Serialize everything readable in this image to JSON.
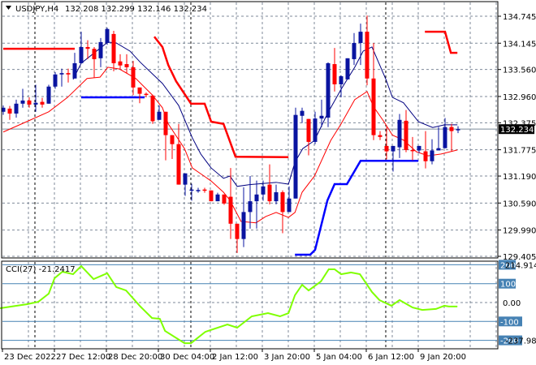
{
  "header": {
    "collapse_icon": "triangle-down-icon",
    "symbol": "USDJPY,H4",
    "ohlc": "132.208 132.299 132.146 132.234"
  },
  "colors": {
    "bull": "#0a14a0",
    "bear": "#ff0000",
    "ma_fast": "#000080",
    "ma_slow": "#ff0000",
    "resistance": "#ff0000",
    "support": "#0000ff",
    "cci": "#7fff00",
    "cci_level": "#4682b4",
    "grid": "#7f8a99"
  },
  "chart_data": [
    {
      "type": "candlestick",
      "title": "USDJPY,H4",
      "ylim": [
        129.405,
        134.745
      ],
      "price_ticks": [
        "134.745",
        "134.145",
        "133.560",
        "132.960",
        "132.375",
        "131.775",
        "131.190",
        "130.590",
        "129.990",
        "129.405"
      ],
      "current_price": "132.234",
      "x_labels": [
        {
          "index": 0,
          "label": "23 Dec 2022"
        },
        {
          "index": 8,
          "label": "27 Dec 12:00"
        },
        {
          "index": 16,
          "label": "28 Dec 20:00"
        },
        {
          "index": 24,
          "label": "30 Dec 04:00"
        },
        {
          "index": 32,
          "label": "2 Jan 12:00"
        },
        {
          "index": 40,
          "label": "3 Jan 20:00"
        },
        {
          "index": 48,
          "label": "5 Jan 04:00"
        },
        {
          "index": 56,
          "label": "6 Jan 12:00"
        },
        {
          "index": 64,
          "label": "9 Jan 20:00"
        }
      ],
      "period_separators": [
        5,
        29,
        59
      ],
      "candles_ohlc": [
        [
          132.62,
          132.76,
          132.55,
          132.71
        ],
        [
          132.69,
          132.75,
          132.44,
          132.58
        ],
        [
          132.58,
          132.89,
          132.49,
          132.8
        ],
        [
          132.8,
          133.13,
          132.71,
          132.87
        ],
        [
          132.87,
          132.94,
          132.71,
          132.78
        ],
        [
          132.78,
          133.22,
          132.62,
          132.82
        ],
        [
          132.84,
          132.93,
          132.71,
          132.78
        ],
        [
          132.8,
          133.22,
          132.8,
          133.18
        ],
        [
          133.18,
          133.5,
          133.13,
          133.45
        ],
        [
          133.45,
          133.58,
          133.18,
          133.48
        ],
        [
          133.48,
          133.58,
          133.27,
          133.45
        ],
        [
          133.36,
          133.93,
          133.36,
          133.7
        ],
        [
          133.7,
          134.4,
          133.7,
          134.06
        ],
        [
          134.06,
          134.21,
          133.79,
          134.02
        ],
        [
          134.02,
          134.06,
          133.38,
          133.79
        ],
        [
          133.81,
          134.26,
          133.61,
          134.17
        ],
        [
          134.15,
          134.49,
          134.11,
          134.46
        ],
        [
          134.35,
          134.42,
          133.52,
          133.7
        ],
        [
          133.74,
          133.9,
          133.57,
          133.65
        ],
        [
          133.68,
          133.9,
          133.48,
          133.61
        ],
        [
          133.61,
          133.75,
          132.99,
          133.16
        ],
        [
          133.16,
          133.16,
          132.81,
          133.02
        ],
        [
          133.02,
          133.05,
          132.94,
          133.0
        ],
        [
          132.98,
          133.0,
          132.35,
          132.41
        ],
        [
          132.44,
          132.76,
          132.44,
          132.62
        ],
        [
          132.62,
          132.62,
          131.54,
          132.1
        ],
        [
          132.1,
          132.1,
          131.57,
          131.9
        ],
        [
          131.9,
          132.35,
          131.0,
          131.0
        ],
        [
          131.0,
          131.25,
          130.75,
          131.25
        ],
        [
          130.88,
          131.02,
          130.64,
          130.89
        ],
        [
          130.87,
          130.93,
          130.82,
          130.88
        ],
        [
          130.89,
          130.93,
          130.82,
          130.87
        ],
        [
          130.87,
          130.87,
          130.63,
          130.63
        ],
        [
          130.63,
          130.82,
          130.63,
          130.78
        ],
        [
          130.78,
          130.78,
          130.55,
          130.58
        ],
        [
          130.73,
          131.37,
          129.79,
          130.13
        ],
        [
          130.13,
          130.13,
          129.48,
          129.79
        ],
        [
          129.79,
          130.94,
          129.61,
          130.39
        ],
        [
          130.39,
          131.19,
          130.02,
          130.63
        ],
        [
          130.63,
          131.09,
          130.02,
          130.78
        ],
        [
          130.78,
          131.09,
          130.64,
          130.96
        ],
        [
          131.0,
          131.45,
          130.56,
          130.63
        ],
        [
          130.63,
          131.0,
          130.56,
          130.83
        ],
        [
          130.83,
          130.87,
          129.92,
          130.39
        ],
        [
          130.39,
          130.96,
          130.39,
          130.69
        ],
        [
          130.69,
          132.71,
          130.69,
          132.55
        ],
        [
          132.53,
          132.71,
          132.37,
          132.64
        ],
        [
          132.46,
          132.46,
          131.65,
          131.95
        ],
        [
          131.95,
          132.62,
          131.9,
          132.47
        ],
        [
          132.47,
          132.89,
          132.28,
          132.53
        ],
        [
          132.49,
          133.72,
          132.28,
          133.7
        ],
        [
          133.68,
          134.04,
          133.07,
          133.23
        ],
        [
          133.23,
          133.43,
          132.94,
          133.41
        ],
        [
          133.34,
          133.81,
          133.34,
          133.81
        ],
        [
          133.79,
          134.37,
          133.66,
          134.15
        ],
        [
          134.15,
          134.58,
          133.66,
          134.4
        ],
        [
          134.4,
          134.76,
          133.21,
          133.36
        ],
        [
          133.36,
          134.15,
          131.99,
          132.1
        ],
        [
          132.1,
          132.19,
          131.99,
          132.06
        ],
        [
          131.86,
          132.28,
          131.56,
          131.74
        ],
        [
          131.74,
          131.86,
          131.29,
          131.86
        ],
        [
          131.83,
          132.57,
          131.59,
          132.44
        ],
        [
          132.42,
          132.66,
          131.72,
          131.77
        ],
        [
          131.77,
          132.06,
          131.54,
          131.76
        ],
        [
          131.76,
          131.86,
          131.7,
          131.86
        ],
        [
          131.74,
          132.19,
          131.36,
          131.52
        ],
        [
          131.52,
          132.01,
          131.45,
          131.76
        ],
        [
          131.76,
          132.28,
          131.76,
          131.81
        ],
        [
          131.81,
          132.48,
          131.81,
          132.28
        ],
        [
          132.28,
          132.35,
          131.74,
          132.19
        ],
        [
          132.208,
          132.299,
          132.146,
          132.234
        ]
      ],
      "series": [
        {
          "name": "ma_fast",
          "points": [
            [
              10.75,
              133.34
            ],
            [
              12,
              133.7
            ],
            [
              16.1,
              134.17
            ],
            [
              17.4,
              134.15
            ],
            [
              19.5,
              133.97
            ],
            [
              21.1,
              133.72
            ],
            [
              24.5,
              133.25
            ],
            [
              27,
              132.76
            ],
            [
              29.1,
              132.04
            ],
            [
              30.4,
              131.68
            ],
            [
              32,
              131.37
            ],
            [
              33.9,
              131.14
            ],
            [
              34.9,
              131.19
            ],
            [
              36,
              130.96
            ],
            [
              37.9,
              131.0
            ],
            [
              42,
              131.05
            ],
            [
              43.9,
              131.01
            ],
            [
              44.9,
              131.5
            ],
            [
              46.1,
              131.8
            ],
            [
              47.9,
              131.98
            ],
            [
              49.9,
              132.58
            ],
            [
              52,
              133.12
            ],
            [
              54.1,
              133.61
            ],
            [
              55.4,
              133.97
            ],
            [
              56.75,
              134.06
            ],
            [
              58.9,
              133.34
            ],
            [
              59.9,
              132.94
            ],
            [
              61.6,
              132.82
            ],
            [
              63.9,
              132.4
            ],
            [
              66.1,
              132.27
            ],
            [
              67.9,
              132.33
            ],
            [
              69.9,
              132.33
            ]
          ]
        },
        {
          "name": "ma_slow",
          "points": [
            [
              0,
              132.17
            ],
            [
              3.6,
              132.4
            ],
            [
              7,
              132.62
            ],
            [
              9.9,
              132.94
            ],
            [
              12.9,
              133.36
            ],
            [
              14.9,
              133.39
            ],
            [
              16.1,
              133.61
            ],
            [
              17.9,
              133.57
            ],
            [
              20.4,
              133.36
            ],
            [
              22.9,
              133.0
            ],
            [
              24.5,
              132.71
            ],
            [
              25.4,
              132.35
            ],
            [
              27.9,
              131.8
            ],
            [
              29.1,
              131.37
            ],
            [
              32,
              131.08
            ],
            [
              33.9,
              130.83
            ],
            [
              34.9,
              130.65
            ],
            [
              36.6,
              130.18
            ],
            [
              38.9,
              130.15
            ],
            [
              40.4,
              130.29
            ],
            [
              42,
              130.38
            ],
            [
              43.9,
              130.27
            ],
            [
              44.9,
              130.38
            ],
            [
              46,
              130.83
            ],
            [
              47.9,
              131.19
            ],
            [
              50.4,
              131.98
            ],
            [
              52,
              132.35
            ],
            [
              54.1,
              132.89
            ],
            [
              56,
              133.07
            ],
            [
              57,
              132.73
            ],
            [
              58.6,
              132.4
            ],
            [
              59.9,
              132.1
            ],
            [
              61.6,
              131.99
            ],
            [
              63.6,
              131.73
            ],
            [
              65.4,
              131.64
            ],
            [
              67.4,
              131.68
            ],
            [
              69.9,
              131.77
            ]
          ]
        },
        {
          "name": "resistance",
          "segments": [
            [
              [
                0,
                134.02
              ],
              [
                11,
                134.02
              ]
            ],
            [
              [
                23.25,
                134.29
              ],
              [
                24.5,
                134.06
              ],
              [
                25.4,
                133.66
              ],
              [
                26.6,
                133.3
              ],
              [
                28.9,
                132.8
              ],
              [
                31,
                132.8
              ],
              [
                32,
                132.4
              ],
              [
                33.9,
                132.35
              ],
              [
                35.75,
                131.62
              ],
              [
                43.9,
                131.61
              ]
            ],
            [
              [
                64.9,
                134.4
              ],
              [
                68,
                134.4
              ],
              [
                68.9,
                133.93
              ],
              [
                69.9,
                133.93
              ]
            ]
          ]
        },
        {
          "name": "support",
          "segments": [
            [
              [
                12,
                132.94
              ],
              [
                21.75,
                132.94
              ]
            ],
            [
              [
                44.9,
                129.44
              ],
              [
                47.25,
                129.44
              ],
              [
                48,
                129.55
              ],
              [
                49.9,
                130.65
              ],
              [
                51,
                131.01
              ],
              [
                52.9,
                131.01
              ],
              [
                55,
                131.53
              ],
              [
                63.9,
                131.53
              ]
            ]
          ]
        }
      ]
    },
    {
      "type": "line",
      "title": "CCI(27)",
      "current_value": "-21.2417",
      "ylim": [
        -237.9803,
        214.9143
      ],
      "max_label": "214.9143",
      "min_label": "-237.9803",
      "levels": [
        {
          "value": 200,
          "label": "200"
        },
        {
          "value": 100,
          "label": "100"
        },
        {
          "value": 0,
          "label": "0.00"
        },
        {
          "value": -100,
          "label": "-100"
        },
        {
          "value": -200,
          "label": "-200"
        }
      ],
      "points": [
        [
          -0.5,
          -30
        ],
        [
          3.6,
          -9
        ],
        [
          5.4,
          4
        ],
        [
          7,
          47
        ],
        [
          7.9,
          129
        ],
        [
          9.1,
          163
        ],
        [
          10.75,
          150
        ],
        [
          12,
          193
        ],
        [
          13.9,
          124
        ],
        [
          16,
          155
        ],
        [
          17.4,
          82
        ],
        [
          18.9,
          64
        ],
        [
          21.1,
          -21
        ],
        [
          22.9,
          -82
        ],
        [
          24.1,
          -86
        ],
        [
          24.9,
          -150
        ],
        [
          27.9,
          -215
        ],
        [
          28.9,
          -215
        ],
        [
          31.1,
          -155
        ],
        [
          34.5,
          -116
        ],
        [
          36,
          -133
        ],
        [
          38.25,
          -73
        ],
        [
          40.75,
          -56
        ],
        [
          42.6,
          -73
        ],
        [
          43.9,
          -56
        ],
        [
          44.9,
          39
        ],
        [
          46,
          94
        ],
        [
          47,
          64
        ],
        [
          48.9,
          112
        ],
        [
          50.1,
          176
        ],
        [
          51,
          176
        ],
        [
          52,
          150
        ],
        [
          53.5,
          159
        ],
        [
          54.9,
          150
        ],
        [
          56.75,
          56
        ],
        [
          57.9,
          13
        ],
        [
          59.75,
          -17
        ],
        [
          61,
          13
        ],
        [
          63,
          -26
        ],
        [
          64.5,
          -39
        ],
        [
          66.6,
          -34
        ],
        [
          67.9,
          -17
        ],
        [
          68.6,
          -21
        ],
        [
          69.9,
          -21
        ]
      ]
    }
  ]
}
